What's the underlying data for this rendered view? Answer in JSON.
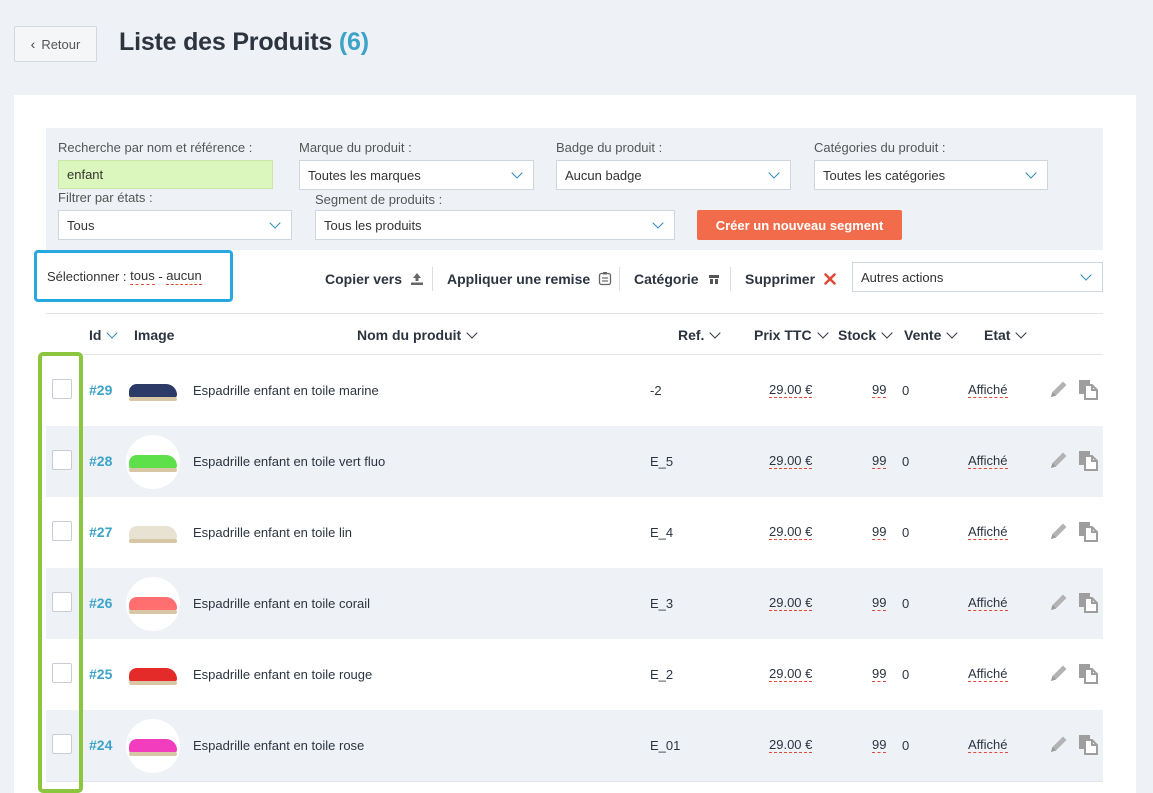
{
  "header": {
    "back_label": "Retour",
    "title": "Liste des Produits",
    "count": "(6)"
  },
  "filters": {
    "search_label": "Recherche par nom et référence :",
    "search_value": "enfant",
    "brand_label": "Marque du produit :",
    "brand_value": "Toutes les marques",
    "badge_label": "Badge du produit :",
    "badge_value": "Aucun badge",
    "category_label": "Catégories du produit :",
    "category_value": "Toutes les catégories",
    "state_label": "Filtrer par états :",
    "state_value": "Tous",
    "segment_label": "Segment de produits :",
    "segment_value": "Tous les produits",
    "create_segment_label": "Créer un nouveau segment"
  },
  "selection": {
    "label": "Sélectionner :",
    "all": "tous",
    "separator": "-",
    "none": "aucun"
  },
  "actions": {
    "copy": "Copier vers",
    "discount": "Appliquer une remise",
    "category": "Catégorie",
    "delete": "Supprimer",
    "other": "Autres actions"
  },
  "columns": {
    "id": "Id",
    "image": "Image",
    "name": "Nom du produit",
    "ref": "Ref.",
    "price": "Prix TTC",
    "stock": "Stock",
    "sale": "Vente",
    "state": "Etat"
  },
  "rows": [
    {
      "id": "#29",
      "name": "Espadrille enfant en toile marine",
      "ref": "-2",
      "price": "29.00 €",
      "stock": "99",
      "sale": "0",
      "state": "Affiché",
      "color": "#2b3a66"
    },
    {
      "id": "#28",
      "name": "Espadrille enfant en toile vert fluo",
      "ref": "E_5",
      "price": "29.00 €",
      "stock": "99",
      "sale": "0",
      "state": "Affiché",
      "color": "#5ee04a"
    },
    {
      "id": "#27",
      "name": "Espadrille enfant en toile lin",
      "ref": "E_4",
      "price": "29.00 €",
      "stock": "99",
      "sale": "0",
      "state": "Affiché",
      "color": "#e8e2d2"
    },
    {
      "id": "#26",
      "name": "Espadrille enfant en toile corail",
      "ref": "E_3",
      "price": "29.00 €",
      "stock": "99",
      "sale": "0",
      "state": "Affiché",
      "color": "#ff6f6f"
    },
    {
      "id": "#25",
      "name": "Espadrille enfant en toile rouge",
      "ref": "E_2",
      "price": "29.00 €",
      "stock": "99",
      "sale": "0",
      "state": "Affiché",
      "color": "#e52a2a"
    },
    {
      "id": "#24",
      "name": "Espadrille enfant en toile rose",
      "ref": "E_01",
      "price": "29.00 €",
      "stock": "99",
      "sale": "0",
      "state": "Affiché",
      "color": "#f23dbf"
    }
  ],
  "colors": {
    "accent_blue": "#3ba3c8",
    "create_button": "#f26b4a",
    "selection_highlight": "#27a8e0",
    "checkbox_highlight": "#8cc63f",
    "search_field": "#dcf7bd"
  }
}
